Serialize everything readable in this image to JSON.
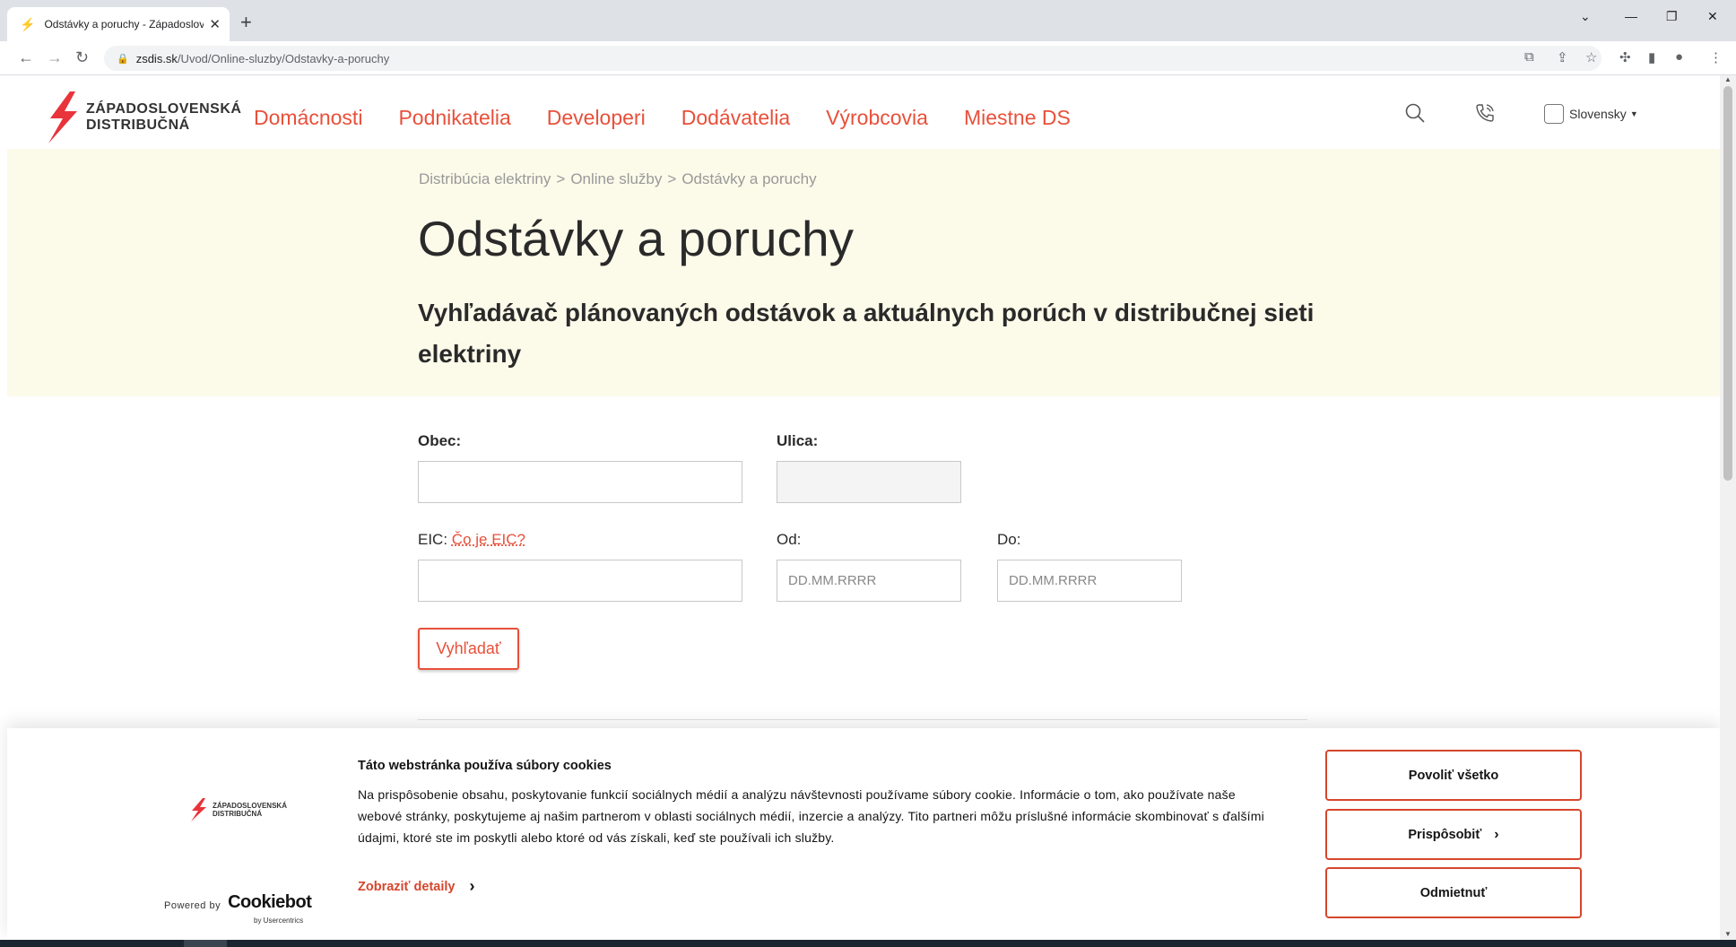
{
  "browser": {
    "tab_title": "Odstávky a poruchy - Západoslovenská distribučná",
    "tab_close": "✕",
    "new_tab": "+",
    "url_domain": "zsdis.sk",
    "url_path": "/Uvod/Online-sluzby/Odstavky-a-poruchy",
    "icons": [
      "back-icon",
      "forward-icon",
      "reload-icon",
      "lock-icon",
      "translate-icon",
      "share-icon",
      "star-icon",
      "extensions-icon",
      "sidepanel-icon",
      "profile-icon",
      "menu-icon"
    ]
  },
  "header": {
    "logo_line1": "ZÁPADOSLOVENSKÁ",
    "logo_line2": "DISTRIBUČNÁ",
    "nav": [
      "Domácnosti",
      "Podnikatelia",
      "Developeri",
      "Dodávatelia",
      "Výrobcovia",
      "Miestne DS"
    ],
    "language": "Slovensky"
  },
  "hero": {
    "breadcrumb": [
      "Distribúcia elektriny",
      "Online služby",
      "Odstávky a poruchy"
    ],
    "breadcrumb_sep": ">",
    "title": "Odstávky a poruchy",
    "subtitle": "Vyhľadávač plánovaných odstávok a aktuálnych porúch v distribučnej sieti elektriny"
  },
  "form": {
    "obec_label": "Obec:",
    "ulica_label": "Ulica:",
    "eic_label": "EIC:",
    "eic_help": "Čo je EIC?",
    "od_label": "Od:",
    "do_label": "Do:",
    "date_placeholder": "DD.MM.RRRR",
    "search_button": "Vyhľadať"
  },
  "cookie": {
    "title": "Táto webstránka používa súbory cookies",
    "text": "Na prispôsobenie obsahu, poskytovanie funkcií sociálnych médií a analýzu návštevnosti používame súbory cookie. Informácie o tom, ako používate naše webové stránky, poskytujeme aj našim partnerom v oblasti sociálnych médií, inzercie a analýzy. Tito partneri môžu príslušné informácie skombinovať s ďalšími údajmi, ktoré ste im poskytli alebo ktoré od vás získali, keď ste používali ich služby.",
    "details_link": "Zobraziť detaily",
    "allow_all": "Povoliť všetko",
    "customize": "Prispôsobiť",
    "reject": "Odmietnuť",
    "powered_by": "Powered by",
    "cookiebot": "Cookiebot",
    "cookiebot_by": "by Usercentrics",
    "logo_line1": "ZÁPADOSLOVENSKÁ",
    "logo_line2": "DISTRIBUČNÁ"
  },
  "colors": {
    "brand": "#e8503a",
    "hero_bg": "#fcfbea",
    "cookie_accent": "#d6462c"
  }
}
